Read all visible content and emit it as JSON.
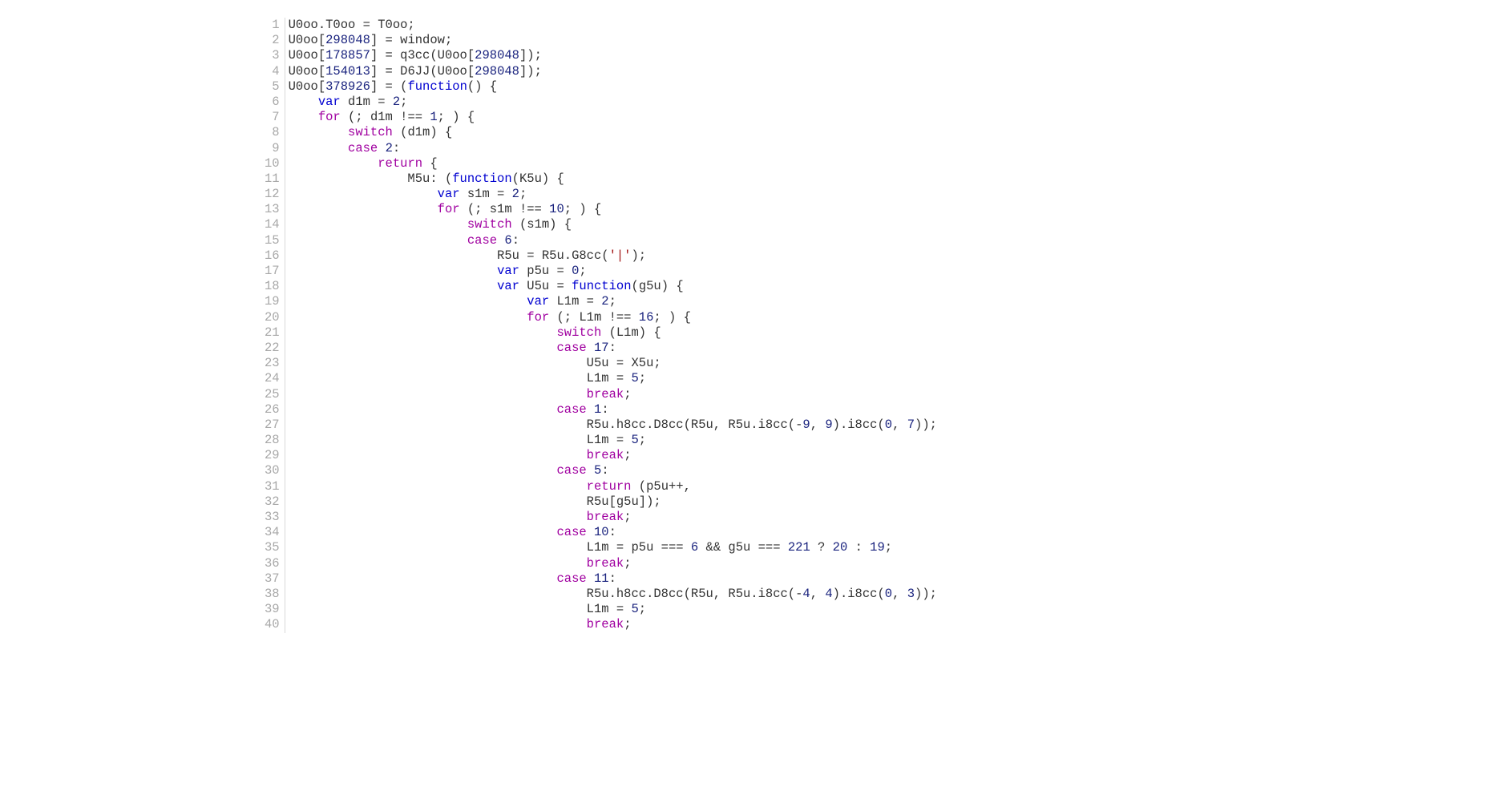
{
  "code_lines": [
    {
      "n": "1",
      "tokens": [
        [
          "p",
          "U0oo.T0oo = T0oo;"
        ]
      ]
    },
    {
      "n": "2",
      "tokens": [
        [
          "p",
          "U0oo["
        ],
        [
          "n",
          "298048"
        ],
        [
          "p",
          "] = window;"
        ]
      ]
    },
    {
      "n": "3",
      "tokens": [
        [
          "p",
          "U0oo["
        ],
        [
          "n",
          "178857"
        ],
        [
          "p",
          "] = q3cc(U0oo["
        ],
        [
          "n",
          "298048"
        ],
        [
          "p",
          "]);"
        ]
      ]
    },
    {
      "n": "4",
      "tokens": [
        [
          "p",
          "U0oo["
        ],
        [
          "n",
          "154013"
        ],
        [
          "p",
          "] = D6JJ(U0oo["
        ],
        [
          "n",
          "298048"
        ],
        [
          "p",
          "]);"
        ]
      ]
    },
    {
      "n": "5",
      "tokens": [
        [
          "p",
          "U0oo["
        ],
        [
          "n",
          "378926"
        ],
        [
          "p",
          "] = ("
        ],
        [
          "k",
          "function"
        ],
        [
          "p",
          "() {"
        ]
      ]
    },
    {
      "n": "6",
      "tokens": [
        [
          "p",
          "    "
        ],
        [
          "k",
          "var"
        ],
        [
          "p",
          " d1m = "
        ],
        [
          "n",
          "2"
        ],
        [
          "p",
          ";"
        ]
      ]
    },
    {
      "n": "7",
      "tokens": [
        [
          "p",
          "    "
        ],
        [
          "sw",
          "for"
        ],
        [
          "p",
          " (; d1m !== "
        ],
        [
          "n",
          "1"
        ],
        [
          "p",
          "; ) {"
        ]
      ]
    },
    {
      "n": "8",
      "tokens": [
        [
          "p",
          "        "
        ],
        [
          "sw",
          "switch"
        ],
        [
          "p",
          " (d1m) {"
        ]
      ]
    },
    {
      "n": "9",
      "tokens": [
        [
          "p",
          "        "
        ],
        [
          "sw",
          "case"
        ],
        [
          "p",
          " "
        ],
        [
          "n",
          "2"
        ],
        [
          "p",
          ":"
        ]
      ]
    },
    {
      "n": "10",
      "tokens": [
        [
          "p",
          "            "
        ],
        [
          "br",
          "return"
        ],
        [
          "p",
          " {"
        ]
      ]
    },
    {
      "n": "11",
      "tokens": [
        [
          "p",
          "                M5u: ("
        ],
        [
          "k",
          "function"
        ],
        [
          "p",
          "(K5u) {"
        ]
      ]
    },
    {
      "n": "12",
      "tokens": [
        [
          "p",
          "                    "
        ],
        [
          "k",
          "var"
        ],
        [
          "p",
          " s1m = "
        ],
        [
          "n",
          "2"
        ],
        [
          "p",
          ";"
        ]
      ]
    },
    {
      "n": "13",
      "tokens": [
        [
          "p",
          "                    "
        ],
        [
          "sw",
          "for"
        ],
        [
          "p",
          " (; s1m !== "
        ],
        [
          "n",
          "10"
        ],
        [
          "p",
          "; ) {"
        ]
      ]
    },
    {
      "n": "14",
      "tokens": [
        [
          "p",
          "                        "
        ],
        [
          "sw",
          "switch"
        ],
        [
          "p",
          " (s1m) {"
        ]
      ]
    },
    {
      "n": "15",
      "tokens": [
        [
          "p",
          "                        "
        ],
        [
          "sw",
          "case"
        ],
        [
          "p",
          " "
        ],
        [
          "n",
          "6"
        ],
        [
          "p",
          ":"
        ]
      ]
    },
    {
      "n": "16",
      "tokens": [
        [
          "p",
          "                            R5u = R5u.G8cc("
        ],
        [
          "s",
          "'|'"
        ],
        [
          "p",
          ");"
        ]
      ]
    },
    {
      "n": "17",
      "tokens": [
        [
          "p",
          "                            "
        ],
        [
          "k",
          "var"
        ],
        [
          "p",
          " p5u = "
        ],
        [
          "n",
          "0"
        ],
        [
          "p",
          ";"
        ]
      ]
    },
    {
      "n": "18",
      "tokens": [
        [
          "p",
          "                            "
        ],
        [
          "k",
          "var"
        ],
        [
          "p",
          " U5u = "
        ],
        [
          "k",
          "function"
        ],
        [
          "p",
          "(g5u) {"
        ]
      ]
    },
    {
      "n": "19",
      "tokens": [
        [
          "p",
          "                                "
        ],
        [
          "k",
          "var"
        ],
        [
          "p",
          " L1m = "
        ],
        [
          "n",
          "2"
        ],
        [
          "p",
          ";"
        ]
      ]
    },
    {
      "n": "20",
      "tokens": [
        [
          "p",
          "                                "
        ],
        [
          "sw",
          "for"
        ],
        [
          "p",
          " (; L1m !== "
        ],
        [
          "n",
          "16"
        ],
        [
          "p",
          "; ) {"
        ]
      ]
    },
    {
      "n": "21",
      "tokens": [
        [
          "p",
          "                                    "
        ],
        [
          "sw",
          "switch"
        ],
        [
          "p",
          " (L1m) {"
        ]
      ]
    },
    {
      "n": "22",
      "tokens": [
        [
          "p",
          "                                    "
        ],
        [
          "sw",
          "case"
        ],
        [
          "p",
          " "
        ],
        [
          "n",
          "17"
        ],
        [
          "p",
          ":"
        ]
      ]
    },
    {
      "n": "23",
      "tokens": [
        [
          "p",
          "                                        U5u = X5u;"
        ]
      ]
    },
    {
      "n": "24",
      "tokens": [
        [
          "p",
          "                                        L1m = "
        ],
        [
          "n",
          "5"
        ],
        [
          "p",
          ";"
        ]
      ]
    },
    {
      "n": "25",
      "tokens": [
        [
          "p",
          "                                        "
        ],
        [
          "br",
          "break"
        ],
        [
          "p",
          ";"
        ]
      ]
    },
    {
      "n": "26",
      "tokens": [
        [
          "p",
          "                                    "
        ],
        [
          "sw",
          "case"
        ],
        [
          "p",
          " "
        ],
        [
          "n",
          "1"
        ],
        [
          "p",
          ":"
        ]
      ]
    },
    {
      "n": "27",
      "tokens": [
        [
          "p",
          "                                        R5u.h8cc.D8cc(R5u, R5u.i8cc(-"
        ],
        [
          "n",
          "9"
        ],
        [
          "p",
          ", "
        ],
        [
          "n",
          "9"
        ],
        [
          "p",
          ").i8cc("
        ],
        [
          "n",
          "0"
        ],
        [
          "p",
          ", "
        ],
        [
          "n",
          "7"
        ],
        [
          "p",
          "));"
        ]
      ]
    },
    {
      "n": "28",
      "tokens": [
        [
          "p",
          "                                        L1m = "
        ],
        [
          "n",
          "5"
        ],
        [
          "p",
          ";"
        ]
      ]
    },
    {
      "n": "29",
      "tokens": [
        [
          "p",
          "                                        "
        ],
        [
          "br",
          "break"
        ],
        [
          "p",
          ";"
        ]
      ]
    },
    {
      "n": "30",
      "tokens": [
        [
          "p",
          "                                    "
        ],
        [
          "sw",
          "case"
        ],
        [
          "p",
          " "
        ],
        [
          "n",
          "5"
        ],
        [
          "p",
          ":"
        ]
      ]
    },
    {
      "n": "31",
      "tokens": [
        [
          "p",
          "                                        "
        ],
        [
          "br",
          "return"
        ],
        [
          "p",
          " (p5u++,"
        ]
      ]
    },
    {
      "n": "32",
      "tokens": [
        [
          "p",
          "                                        R5u[g5u]);"
        ]
      ]
    },
    {
      "n": "33",
      "tokens": [
        [
          "p",
          "                                        "
        ],
        [
          "br",
          "break"
        ],
        [
          "p",
          ";"
        ]
      ]
    },
    {
      "n": "34",
      "tokens": [
        [
          "p",
          "                                    "
        ],
        [
          "sw",
          "case"
        ],
        [
          "p",
          " "
        ],
        [
          "n",
          "10"
        ],
        [
          "p",
          ":"
        ]
      ]
    },
    {
      "n": "35",
      "tokens": [
        [
          "p",
          "                                        L1m = p5u === "
        ],
        [
          "n",
          "6"
        ],
        [
          "p",
          " && g5u === "
        ],
        [
          "n",
          "221"
        ],
        [
          "p",
          " ? "
        ],
        [
          "n",
          "20"
        ],
        [
          "p",
          " : "
        ],
        [
          "n",
          "19"
        ],
        [
          "p",
          ";"
        ]
      ]
    },
    {
      "n": "36",
      "tokens": [
        [
          "p",
          "                                        "
        ],
        [
          "br",
          "break"
        ],
        [
          "p",
          ";"
        ]
      ]
    },
    {
      "n": "37",
      "tokens": [
        [
          "p",
          "                                    "
        ],
        [
          "sw",
          "case"
        ],
        [
          "p",
          " "
        ],
        [
          "n",
          "11"
        ],
        [
          "p",
          ":"
        ]
      ]
    },
    {
      "n": "38",
      "tokens": [
        [
          "p",
          "                                        R5u.h8cc.D8cc(R5u, R5u.i8cc(-"
        ],
        [
          "n",
          "4"
        ],
        [
          "p",
          ", "
        ],
        [
          "n",
          "4"
        ],
        [
          "p",
          ").i8cc("
        ],
        [
          "n",
          "0"
        ],
        [
          "p",
          ", "
        ],
        [
          "n",
          "3"
        ],
        [
          "p",
          "));"
        ]
      ]
    },
    {
      "n": "39",
      "tokens": [
        [
          "p",
          "                                        L1m = "
        ],
        [
          "n",
          "5"
        ],
        [
          "p",
          ";"
        ]
      ]
    },
    {
      "n": "40",
      "tokens": [
        [
          "p",
          "                                        "
        ],
        [
          "br",
          "break"
        ],
        [
          "p",
          ";"
        ]
      ]
    }
  ]
}
